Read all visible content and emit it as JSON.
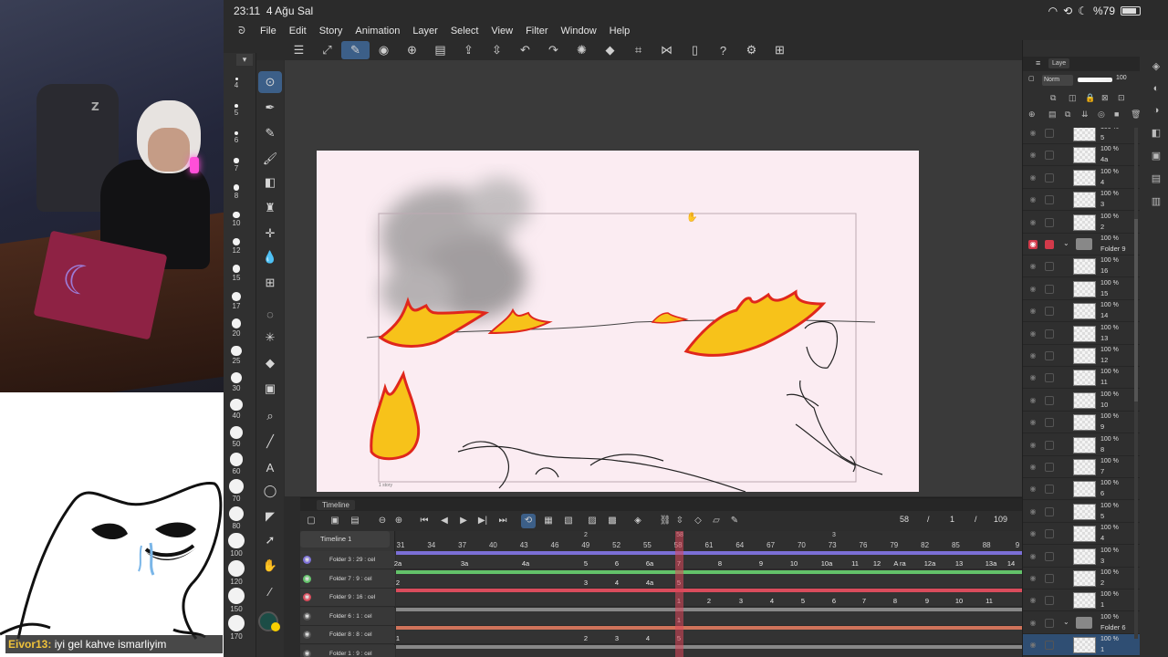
{
  "status": {
    "time": "23:11",
    "date": "4 Ağu Sal",
    "battery": "%79"
  },
  "menu": [
    "File",
    "Edit",
    "Story",
    "Animation",
    "Layer",
    "Select",
    "View",
    "Filter",
    "Window",
    "Help"
  ],
  "toolbar_icons": [
    "menu-icon",
    "transform-icon",
    "pen-edit-icon",
    "palette-icon",
    "new-file-icon",
    "open-icon",
    "export-icon",
    "spinner-icon",
    "undo-icon",
    "redo-icon",
    "loading-icon",
    "fill-icon",
    "crop-icon",
    "flip-icon",
    "page-icon",
    "help-icon",
    "settings-icon",
    "grid-icon"
  ],
  "brush_sizes": [
    "4",
    "5",
    "6",
    "7",
    "8",
    "10",
    "12",
    "15",
    "17",
    "20",
    "25",
    "30",
    "40",
    "50",
    "60",
    "70",
    "80",
    "100",
    "120",
    "150",
    "170"
  ],
  "tools": [
    "eyedropper",
    "pen",
    "pencil",
    "brush",
    "eraser",
    "decoration",
    "move",
    "blend",
    "frame",
    "lasso",
    "magic-wand",
    "fill",
    "gradient",
    "text-layer",
    "line",
    "text",
    "balloon",
    "select",
    "operation",
    "hand",
    "color-picker"
  ],
  "canvas": {
    "story_label": "1 story"
  },
  "timeline": {
    "panel_title": "Timeline",
    "name": "Timeline 1",
    "frame_info": {
      "current": "58",
      "sep1": "/",
      "mid": "1",
      "sep2": "/",
      "total": "109"
    },
    "ruler": [
      "31",
      "34",
      "37",
      "40",
      "43",
      "46",
      "49",
      "52",
      "55",
      "58",
      "61",
      "64",
      "67",
      "70",
      "73",
      "76",
      "79",
      "82",
      "85",
      "88",
      "9"
    ],
    "ruler_marks": [
      "2",
      "58",
      "3"
    ],
    "tracks": [
      {
        "name": "Folder 3 : 29 : cel",
        "color": "#7b6fd6",
        "cels": [
          "2a",
          "3a",
          "4a",
          "5",
          "6",
          "6a",
          "7",
          "8",
          "9",
          "10",
          "10a",
          "11",
          "12",
          "A ra",
          "12a",
          "13",
          "13a",
          "14"
        ]
      },
      {
        "name": "Folder 7 : 9 : cel",
        "color": "#63c26a",
        "cels": [
          "2",
          "3",
          "4",
          "4a",
          "5"
        ]
      },
      {
        "name": "Folder 9 : 16 : cel",
        "color": "#d94c5c",
        "cels": [
          "1",
          "2",
          "3",
          "4",
          "5",
          "6",
          "7",
          "8",
          "9",
          "10",
          "11"
        ]
      },
      {
        "name": "Folder 6 : 1 : cel",
        "color": "#888888",
        "cels": [
          "1"
        ]
      },
      {
        "name": "Folder 8 : 8 : cel",
        "color": "#d0735a",
        "cels": [
          "1",
          "2",
          "3",
          "4",
          "5"
        ]
      },
      {
        "name": "Folder 1 : 9 : cel",
        "color": "#888888",
        "cels": []
      }
    ]
  },
  "layers_panel": {
    "tab": "Laye",
    "blend_mode": "Norm",
    "opacity": "100",
    "layers": [
      {
        "pct": "100 %",
        "name": "5",
        "type": "cel"
      },
      {
        "pct": "100 %",
        "name": "4a",
        "type": "cel"
      },
      {
        "pct": "100 %",
        "name": "4",
        "type": "cel"
      },
      {
        "pct": "100 %",
        "name": "3",
        "type": "cel"
      },
      {
        "pct": "100 %",
        "name": "2",
        "type": "cel"
      },
      {
        "pct": "100 %",
        "name": "Folder 9",
        "type": "folder",
        "red": true
      },
      {
        "pct": "100 %",
        "name": "16",
        "type": "cel"
      },
      {
        "pct": "100 %",
        "name": "15",
        "type": "cel"
      },
      {
        "pct": "100 %",
        "name": "14",
        "type": "cel"
      },
      {
        "pct": "100 %",
        "name": "13",
        "type": "cel"
      },
      {
        "pct": "100 %",
        "name": "12",
        "type": "cel"
      },
      {
        "pct": "100 %",
        "name": "11",
        "type": "cel"
      },
      {
        "pct": "100 %",
        "name": "10",
        "type": "cel"
      },
      {
        "pct": "100 %",
        "name": "9",
        "type": "cel"
      },
      {
        "pct": "100 %",
        "name": "8",
        "type": "cel"
      },
      {
        "pct": "100 %",
        "name": "7",
        "type": "cel"
      },
      {
        "pct": "100 %",
        "name": "6",
        "type": "cel"
      },
      {
        "pct": "100 %",
        "name": "5",
        "type": "cel"
      },
      {
        "pct": "100 %",
        "name": "4",
        "type": "cel"
      },
      {
        "pct": "100 %",
        "name": "3",
        "type": "cel"
      },
      {
        "pct": "100 %",
        "name": "2",
        "type": "cel"
      },
      {
        "pct": "100 %",
        "name": "1",
        "type": "cel"
      },
      {
        "pct": "100 %",
        "name": "Folder 6",
        "type": "folder"
      },
      {
        "pct": "100 %",
        "name": "1",
        "type": "cel",
        "selected": true
      }
    ]
  },
  "chat": {
    "user": "Eivor13:",
    "message": "iyi gel kahve ismarliyim"
  },
  "colors": {
    "accent": "#3c5f88",
    "canvas_bg": "#fbecf2",
    "fire_yellow": "#f7c21a",
    "fire_red": "#e0271c"
  }
}
